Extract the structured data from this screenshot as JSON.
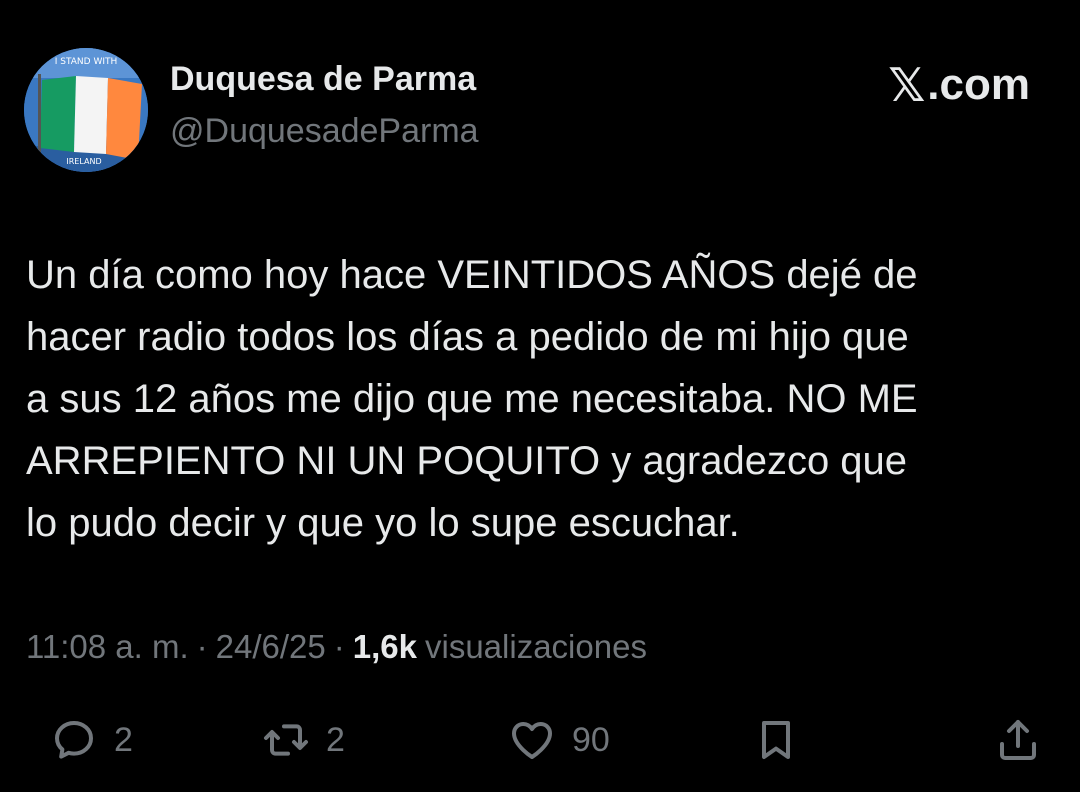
{
  "author": {
    "display_name": "Duquesa de Parma",
    "handle": "@DuquesadeParma",
    "avatar_text_top": "I STAND WITH",
    "avatar_text_bottom": "IRELAND"
  },
  "brand": {
    "label": ".com",
    "glyph": "𝕏"
  },
  "tweet": {
    "text": "Un día como hoy hace VEINTIDOS AÑOS dejé de\nhacer radio todos los días a pedido de mi hijo que\na sus 12 años me dijo que me necesitaba. NO ME\nARREPIENTO NI UN POQUITO y agradezco que\nlo pudo decir y que yo lo supe escuchar."
  },
  "meta": {
    "time": "11:08 a. m.",
    "separator": "·",
    "date": "24/6/25",
    "views_count": "1,6k",
    "views_label": "visualizaciones"
  },
  "actions": {
    "replies": "2",
    "reposts": "2",
    "likes": "90"
  },
  "colors": {
    "background": "#000000",
    "text": "#e7e9ea",
    "secondary": "#71767b"
  }
}
